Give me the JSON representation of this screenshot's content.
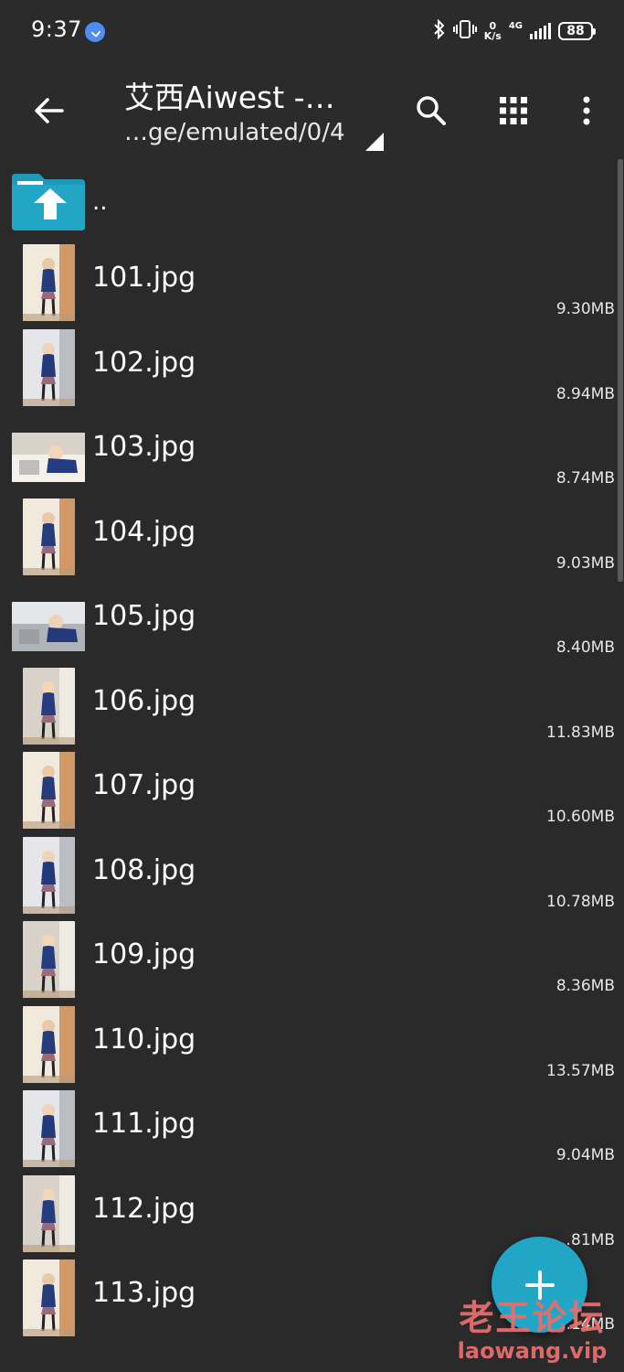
{
  "status_bar": {
    "time": "9:37",
    "net_speed_top": "0",
    "net_speed_bottom": "K/s",
    "net_type": "4G",
    "battery": "88"
  },
  "toolbar": {
    "title": "艾西Aiwest -…",
    "path": "…ge/emulated/0/4",
    "back_icon": "arrow-left-icon",
    "search_icon": "search-icon",
    "grid_icon": "grid-view-icon",
    "more_icon": "more-vert-icon"
  },
  "list": {
    "parent_label": "..",
    "files": [
      {
        "name": "101.jpg",
        "size": "9.30MB"
      },
      {
        "name": "102.jpg",
        "size": "8.94MB"
      },
      {
        "name": "103.jpg",
        "size": "8.74MB"
      },
      {
        "name": "104.jpg",
        "size": "9.03MB"
      },
      {
        "name": "105.jpg",
        "size": "8.40MB"
      },
      {
        "name": "106.jpg",
        "size": "11.83MB"
      },
      {
        "name": "107.jpg",
        "size": "10.60MB"
      },
      {
        "name": "108.jpg",
        "size": "10.78MB"
      },
      {
        "name": "109.jpg",
        "size": "8.36MB"
      },
      {
        "name": "110.jpg",
        "size": "13.57MB"
      },
      {
        "name": "111.jpg",
        "size": "9.04MB"
      },
      {
        "name": "112.jpg",
        "size": "…81MB"
      },
      {
        "name": "113.jpg",
        "size": "11.14MB"
      }
    ]
  },
  "fab": {
    "icon": "plus-icon"
  },
  "watermark": {
    "title": "老王论坛",
    "url": "laowang.vip"
  },
  "colors": {
    "background": "#2a2a2a",
    "accent": "#22a6c6",
    "folder": "#22a6c6",
    "watermark": "#e66e6e"
  }
}
